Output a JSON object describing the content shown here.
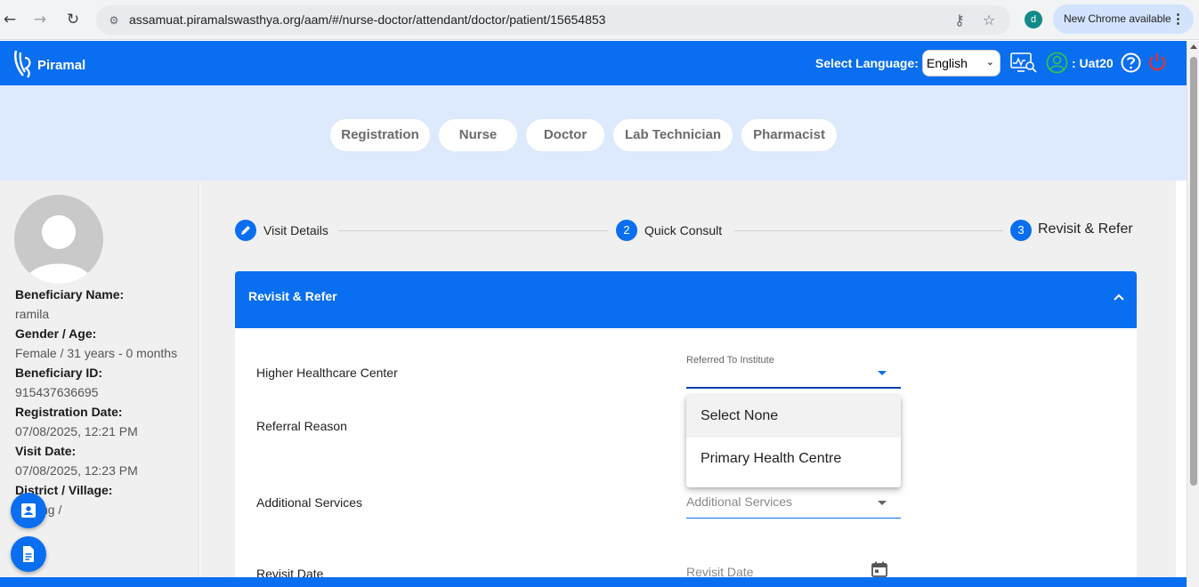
{
  "browser": {
    "url": "assamuat.piramalswasthya.org/aam/#/nurse-doctor/attendant/doctor/patient/15654853",
    "profile_initial": "d",
    "update_label": "New Chrome available"
  },
  "header": {
    "brand": "Piramal",
    "language_label": "Select Language:",
    "language_value": "English",
    "username": ": Uat20"
  },
  "role_tabs": [
    "Registration",
    "Nurse",
    "Doctor",
    "Lab Technician",
    "Pharmacist"
  ],
  "beneficiary": {
    "name_label": "Beneficiary Name:",
    "name": "ramila",
    "gender_age_label": "Gender / Age:",
    "gender_age": "Female / 31 years - 0 months",
    "id_label": "Beneficiary ID:",
    "id": "915437636695",
    "registration_date_label": "Registration Date:",
    "registration_date": "07/08/2025, 12:21 PM",
    "visit_date_label": "Visit Date:",
    "visit_date": "07/08/2025, 12:23 PM",
    "district_label": "District / Village:",
    "district": "ng /"
  },
  "stepper": {
    "steps": [
      {
        "number": "",
        "label": "Visit Details",
        "icon": "pencil-icon"
      },
      {
        "number": "2",
        "label": "Quick Consult"
      },
      {
        "number": "3",
        "label": "Revisit & Refer"
      }
    ]
  },
  "panel": {
    "title": "Revisit & Refer",
    "rows": {
      "higher_healthcare_label": "Higher Healthcare Center",
      "referred_to_float_label": "Referred To Institute",
      "referral_reason_label": "Referral Reason",
      "additional_services_label": "Additional Services",
      "additional_services_placeholder": "Additional Services",
      "revisit_date_label": "Revisit Date",
      "revisit_date_placeholder": "Revisit Date"
    }
  },
  "dropdown": {
    "options": [
      "Select None",
      "Primary Health Centre"
    ],
    "highlighted_index": 0
  },
  "colors": {
    "primary": "#0a6ef0",
    "role_band": "#dde9fd",
    "sidebar_bg": "#f0f0f0",
    "power_icon": "#e8312f",
    "user_icon": "#2ecc40"
  }
}
